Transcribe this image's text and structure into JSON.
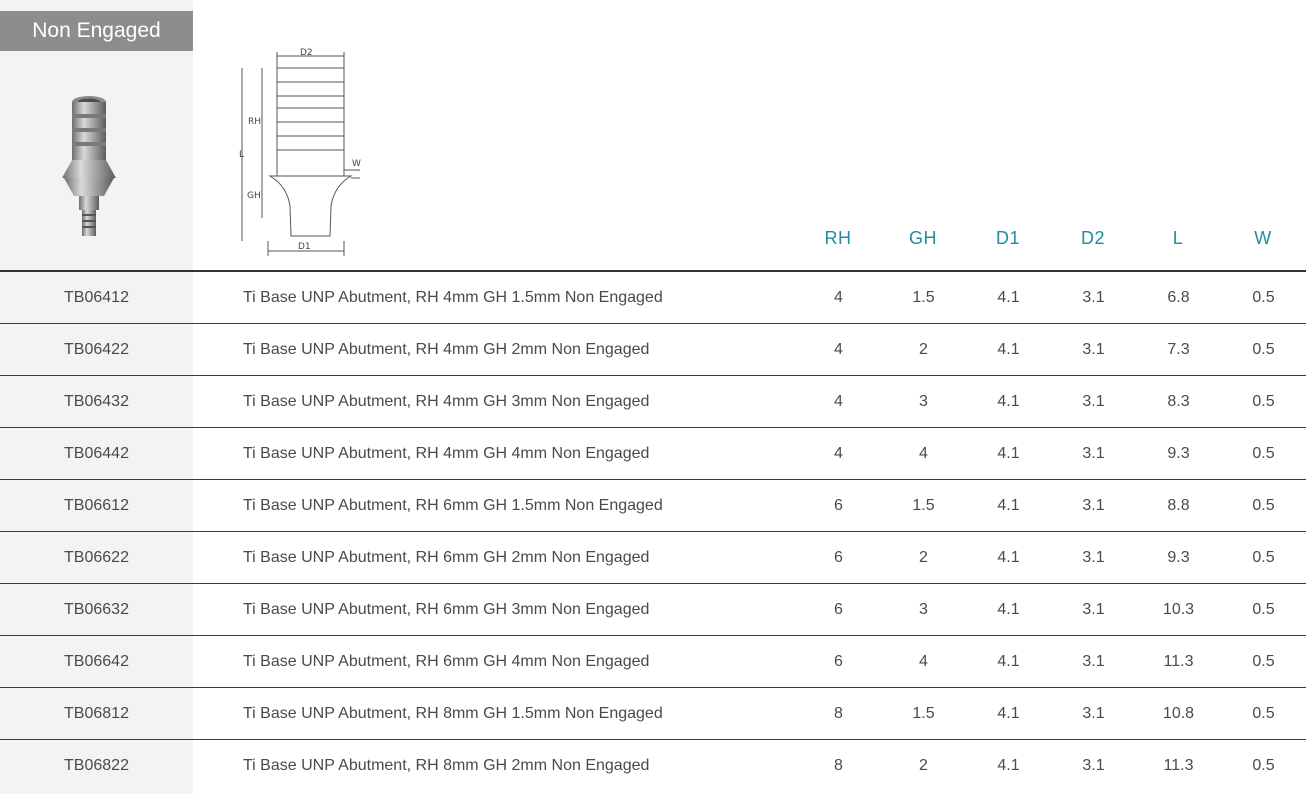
{
  "section": {
    "badge": "Non Engaged"
  },
  "drawing": {
    "labels": {
      "d2": "D2",
      "rh": "RH",
      "l": "L",
      "w": "W",
      "gh": "GH",
      "d1": "D1"
    }
  },
  "table": {
    "headers": [
      "RH",
      "GH",
      "D1",
      "D2",
      "L",
      "W"
    ],
    "rows": [
      {
        "code": "TB06412",
        "desc": "Ti Base UNP Abutment, RH 4mm GH 1.5mm Non Engaged",
        "rh": "4",
        "gh": "1.5",
        "d1": "4.1",
        "d2": "3.1",
        "l": "6.8",
        "w": "0.5"
      },
      {
        "code": "TB06422",
        "desc": "Ti Base UNP Abutment, RH 4mm GH 2mm Non Engaged",
        "rh": "4",
        "gh": "2",
        "d1": "4.1",
        "d2": "3.1",
        "l": "7.3",
        "w": "0.5"
      },
      {
        "code": "TB06432",
        "desc": "Ti Base UNP Abutment, RH 4mm GH 3mm Non Engaged",
        "rh": "4",
        "gh": "3",
        "d1": "4.1",
        "d2": "3.1",
        "l": "8.3",
        "w": "0.5"
      },
      {
        "code": "TB06442",
        "desc": "Ti Base UNP Abutment, RH 4mm GH 4mm Non Engaged",
        "rh": "4",
        "gh": "4",
        "d1": "4.1",
        "d2": "3.1",
        "l": "9.3",
        "w": "0.5"
      },
      {
        "code": "TB06612",
        "desc": "Ti Base UNP Abutment, RH 6mm GH 1.5mm Non Engaged",
        "rh": "6",
        "gh": "1.5",
        "d1": "4.1",
        "d2": "3.1",
        "l": "8.8",
        "w": "0.5"
      },
      {
        "code": "TB06622",
        "desc": "Ti Base UNP Abutment, RH 6mm GH 2mm Non Engaged",
        "rh": "6",
        "gh": "2",
        "d1": "4.1",
        "d2": "3.1",
        "l": "9.3",
        "w": "0.5"
      },
      {
        "code": "TB06632",
        "desc": "Ti Base UNP Abutment, RH 6mm GH 3mm Non Engaged",
        "rh": "6",
        "gh": "3",
        "d1": "4.1",
        "d2": "3.1",
        "l": "10.3",
        "w": "0.5"
      },
      {
        "code": "TB06642",
        "desc": "Ti Base UNP Abutment, RH 6mm GH 4mm Non Engaged",
        "rh": "6",
        "gh": "4",
        "d1": "4.1",
        "d2": "3.1",
        "l": "11.3",
        "w": "0.5"
      },
      {
        "code": "TB06812",
        "desc": "Ti Base UNP Abutment, RH 8mm GH 1.5mm Non Engaged",
        "rh": "8",
        "gh": "1.5",
        "d1": "4.1",
        "d2": "3.1",
        "l": "10.8",
        "w": "0.5"
      },
      {
        "code": "TB06822",
        "desc": "Ti Base UNP Abutment, RH 8mm GH 2mm Non Engaged",
        "rh": "8",
        "gh": "2",
        "d1": "4.1",
        "d2": "3.1",
        "l": "11.3",
        "w": "0.5"
      }
    ]
  },
  "colors": {
    "accent": "#1f8da0",
    "badge_bg": "#8d8d8d",
    "strip_bg": "#f3f3f3"
  }
}
